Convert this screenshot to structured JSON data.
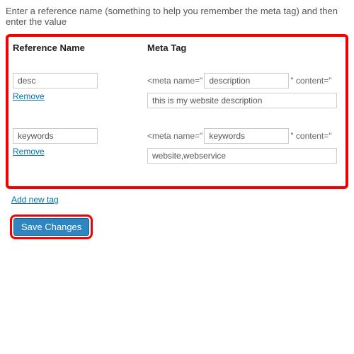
{
  "intro_text": "Enter a reference name (something to help you remember the meta tag) and then enter the value",
  "headers": {
    "reference": "Reference Name",
    "meta": "Meta Tag"
  },
  "labels": {
    "meta_prefix": "<meta name=\"",
    "meta_mid": "\" content=\"",
    "remove": "Remove",
    "add_new": "Add new tag",
    "save": "Save Changes"
  },
  "rows": [
    {
      "reference": "desc",
      "meta_name": "description",
      "meta_content": "this is my website description"
    },
    {
      "reference": "keywords",
      "meta_name": "keywords",
      "meta_content": "website,webservice"
    }
  ]
}
